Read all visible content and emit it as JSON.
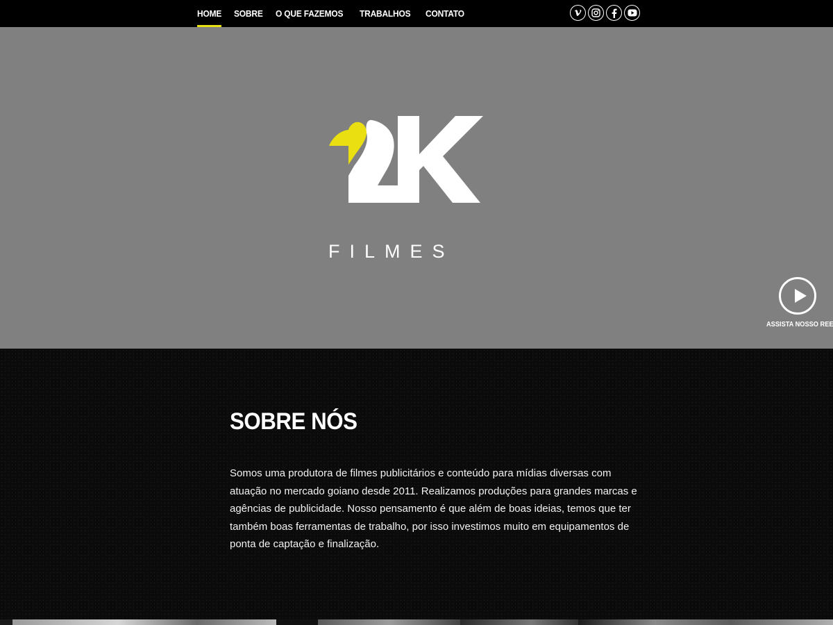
{
  "nav": {
    "items": [
      {
        "label": "HOME",
        "active": true
      },
      {
        "label": "SOBRE",
        "active": false
      },
      {
        "label": "O QUE FAZEMOS",
        "active": false
      },
      {
        "label": "TRABALHOS",
        "active": false
      },
      {
        "label": "CONTATO",
        "active": false
      }
    ],
    "socials": [
      "vimeo-icon",
      "instagram-icon",
      "facebook-icon",
      "youtube-icon"
    ],
    "accent_color": "#eadf10"
  },
  "hero": {
    "logo_wordmark": "2K",
    "logo_text": "FILMES",
    "reel_label": "ASSISTA NOSSO REEL",
    "background_color": "#808080",
    "logo_accent_color": "#eadf10"
  },
  "about": {
    "title": "SOBRE NÓS",
    "paragraph": "Somos uma produtora de filmes publicitários e conteúdo para mídias diversas com atuação no mercado goiano desde 2011. Realizamos produções para grandes marcas e agências de publicidade. Nosso pensamento é que além de boas ideias, temos que ter também boas ferramentas de trabalho, por isso investimos muito em equipamentos de ponta de captação e finalização."
  }
}
